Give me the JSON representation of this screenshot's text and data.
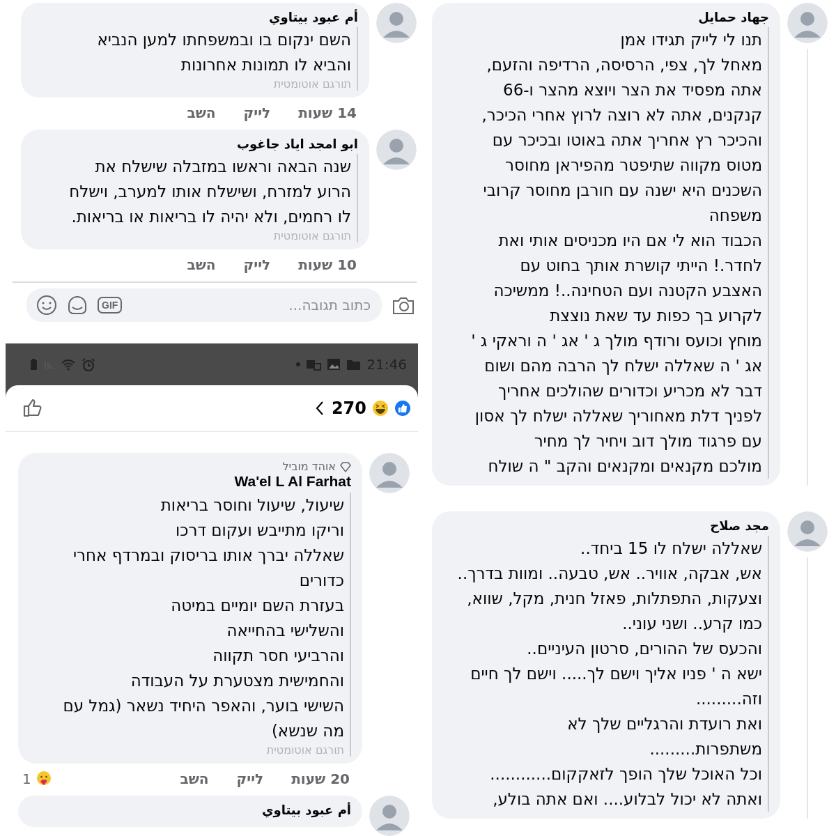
{
  "panels": [
    {
      "kind": "comments",
      "comments": [
        {
          "name": "أم عبود بيتاوي",
          "text": "השם ינקום בו ובמשפחתו למען הנביא\nוהביא לו תמונות אחרונות",
          "translation": "תורגם אוטומטית",
          "time": "14 שעות",
          "like": "לייק",
          "reply": "השב",
          "threaded": false
        },
        {
          "name": "ابو امجد اياد جاغوب",
          "text": "שנה הבאה וראשו במזבלה שישלח את\nהרוע למזרח, ושישלח אותו למערב, וישלח\nלו רחמים, ולא יהיה לו בריאות או בריאות.",
          "translation": "תורגם אוטומטית",
          "time": "10 שעות",
          "like": "לייק",
          "reply": "השב",
          "threaded": false
        }
      ],
      "composer": {
        "placeholder": "כתוב תגובה...",
        "gif": "GIF"
      }
    },
    {
      "kind": "reactions_sheet",
      "status_bar": {
        "time": "21:46"
      },
      "reaction_count": "270",
      "comments": [
        {
          "badge": "אוהד מוביל",
          "name": "Wa'el L Al Farhat",
          "text": "שיעול, שיעול וחוסר בריאות\nוריקו מתייבש ועקום דרכו\nשאללה יברך אותו בריסוק ובמרדף אחרי\nכדורים\nבעזרת השם יומיים במיטה\nוהשלישי בהחייאה\nוהרביעי חסר תקווה\nוהחמישית מצטערת על העבודה\nהשישי בוער, והאפר היחיד נשאר (גמל עם\nמה שנשא)",
          "translation": "תורגם אוטומטית",
          "time": "20 שעות",
          "like": "לייק",
          "reply": "השב",
          "reactions": "1",
          "threaded": false
        },
        {
          "name": "أم عبود بيتاوي",
          "threaded": false
        }
      ]
    },
    {
      "kind": "comments",
      "comments": [
        {
          "name": "جهاد حمايل",
          "text": "תנו לי לייק תגידו אמן\nמאחל לך, צפי, הרסיסה, הרדיפה והזעם,\nאתה מפסיד את הצר ויוצא מהצר ו-66\nקנקנים, אתה לא רוצה לרוץ אחרי הכיכר,\nוהכיכר רץ אחריך אתה באוטו ובכיכר עם\nמטוס מקווה שתיפטר מהפיראן מחוסר\nהשכנים היא ישנה עם חורבן מחוסר קרובי\nמשפחה\nהכבוד הוא לי אם היו מכניסים אותי ואת\nלחדר.! הייתי קושרת אותך בחוט עם\nהאצבע הקטנה ועם הטחינה..! ממשיכה\nלקרוע בך כפות עד שאת נוצצת\nמוחץ וכועס ורודף מולך ג ' אג ' ה וראקי ג '\nאג ' ה שאללה ישלח לך הרבה מהם ושום\nדבר לא מכריע וכדורים שהולכים אחריך\nלפניך דלת מאחוריך שאללה ישלח לך אסון\nעם פרגוד מולך דוב ויחיר לך מחיר\nמולכם מקנאים ומקנאים והקב \" ה שולח",
          "threaded": true
        }
      ]
    },
    {
      "kind": "comments",
      "comments": [
        {
          "name": "مجد صلاح",
          "text": "שאללה ישלח לו 15 ביחד..\nאש, אבקה, אוויר.. אש, טבעה.. ומוות בדרך..\nוצעקות, התפתלות, פאזל חנית, מקל, שווא,\nכמו קרע.. ושני עוני..\nוהכעס של ההורים, סרטון העיניים..\nישא ה ' פניו אליך וישם לך..... וישם לך חיים\nוזה.........\nואת רועדת והרגליים שלך לא\nמשתפרות.........\nוכל האוכל שלך הופך לזאקקום............\nואתה לא יכול לבלוע.... ואם אתה בולע,",
          "threaded": true
        }
      ]
    }
  ]
}
